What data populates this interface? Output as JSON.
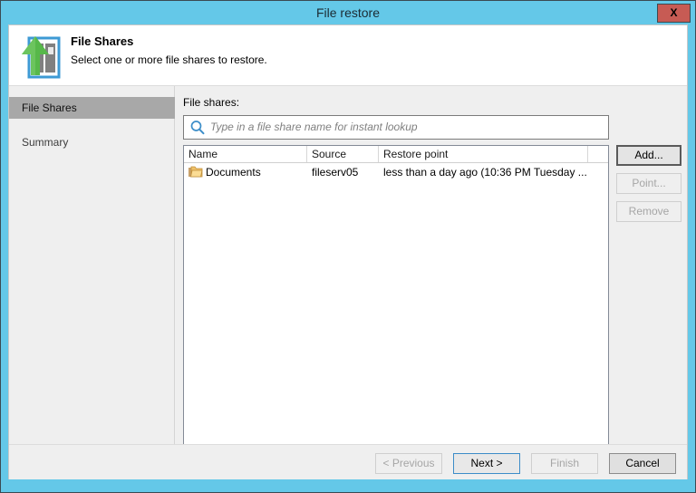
{
  "window": {
    "title": "File restore",
    "close_label": "X",
    "frame_color": "#64c8e8",
    "close_color": "#c75b54"
  },
  "header": {
    "title": "File Shares",
    "subtitle": "Select one or more file shares to restore.",
    "icon": "file-share-restore-icon"
  },
  "sidebar": {
    "items": [
      {
        "label": "File Shares",
        "selected": true
      },
      {
        "label": "Summary",
        "selected": false
      }
    ]
  },
  "main": {
    "field_label": "File shares:",
    "search": {
      "placeholder": "Type in a file share name for instant lookup",
      "value": "",
      "icon": "search-icon"
    },
    "table": {
      "columns": [
        "Name",
        "Source",
        "Restore point",
        ""
      ],
      "rows": [
        {
          "icon": "folder-icon",
          "name": "Documents",
          "source": "fileserv05",
          "restore_point": "less than a day ago (10:36 PM Tuesday ..."
        }
      ]
    },
    "side_buttons": [
      {
        "label": "Add...",
        "enabled": true,
        "default": true
      },
      {
        "label": "Point...",
        "enabled": false,
        "default": false
      },
      {
        "label": "Remove",
        "enabled": false,
        "default": false
      }
    ]
  },
  "footer": {
    "buttons": [
      {
        "label": "< Previous",
        "enabled": false,
        "accent": false
      },
      {
        "label": "Next >",
        "enabled": true,
        "accent": true
      },
      {
        "label": "Finish",
        "enabled": false,
        "accent": false
      },
      {
        "label": "Cancel",
        "enabled": true,
        "accent": false
      }
    ]
  }
}
